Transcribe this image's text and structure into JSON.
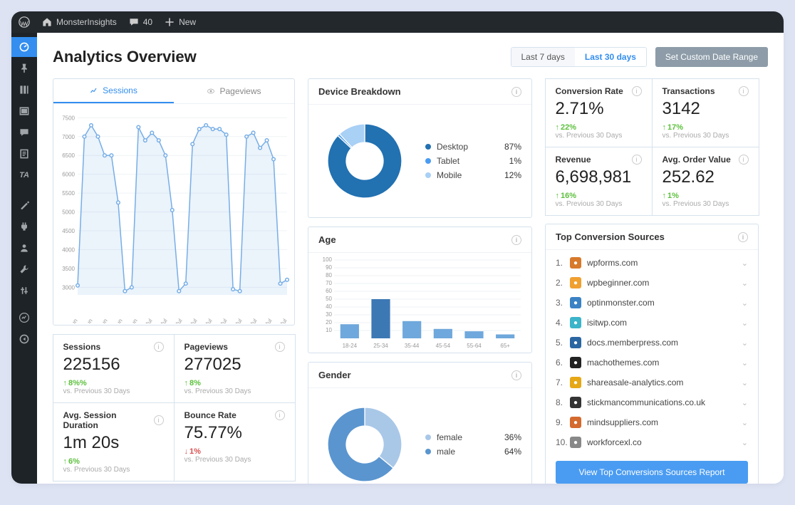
{
  "adminbar": {
    "site_name": "MonsterInsights",
    "comments_count": "40",
    "new_label": "New"
  },
  "page_title": "Analytics Overview",
  "date_tabs": {
    "last7": "Last 7 days",
    "last30": "Last 30 days",
    "custom_btn": "Set Custom Date Range"
  },
  "chart_tabs": {
    "sessions": "Sessions",
    "pageviews": "Pageviews"
  },
  "chart_data": {
    "sessions_line": {
      "type": "line",
      "y_ticks": [
        3000,
        3500,
        4000,
        4500,
        5000,
        5500,
        6000,
        6500,
        7000,
        7500
      ],
      "x_labels": [
        "22 Jun",
        "24 Jun",
        "26 Jun",
        "28 Jun",
        "30 Jun",
        "2 Jul",
        "4 Jul",
        "6 Jul",
        "8 Jul",
        "10 Jul",
        "12 Jul",
        "14 Jul",
        "16 Jul",
        "18 Jul",
        "21 Jul"
      ],
      "points": [
        3050,
        7000,
        7300,
        7000,
        6500,
        6500,
        5250,
        2900,
        3000,
        7250,
        6900,
        7100,
        6900,
        6500,
        5050,
        2900,
        3100,
        6800,
        7200,
        7300,
        7200,
        7200,
        7050,
        2950,
        2900,
        7000,
        7100,
        6700,
        6900,
        6400,
        3100,
        3200
      ],
      "ylim": [
        2800,
        7600
      ]
    },
    "device_donut": {
      "type": "pie",
      "title": "Device Breakdown",
      "series": [
        {
          "name": "Desktop",
          "value": 87,
          "color": "#2271b1"
        },
        {
          "name": "Tablet",
          "value": 1,
          "color": "#4a9cf2"
        },
        {
          "name": "Mobile",
          "value": 12,
          "color": "#a9d0f5"
        }
      ]
    },
    "age_bar": {
      "type": "bar",
      "title": "Age",
      "y_ticks": [
        10,
        20,
        30,
        40,
        50,
        60,
        70,
        80,
        90,
        100
      ],
      "categories": [
        "18-24",
        "25-34",
        "35-44",
        "45-54",
        "55-64",
        "65+"
      ],
      "values": [
        18,
        50,
        22,
        12,
        9,
        5
      ]
    },
    "gender_donut": {
      "type": "pie",
      "title": "Gender",
      "series": [
        {
          "name": "female",
          "value": 36,
          "color": "#a9c8e8"
        },
        {
          "name": "male",
          "value": 64,
          "color": "#5a95cf"
        }
      ]
    }
  },
  "stats": {
    "sessions": {
      "label": "Sessions",
      "value": "225156",
      "delta": "8%%",
      "dir": "up",
      "sub": "vs. Previous 30 Days"
    },
    "pageviews": {
      "label": "Pageviews",
      "value": "277025",
      "delta": "8%",
      "dir": "up",
      "sub": "vs. Previous 30 Days"
    },
    "avg_session": {
      "label": "Avg. Session Duration",
      "value": "1m 20s",
      "delta": "6%",
      "dir": "up",
      "sub": "vs. Previous 30 Days"
    },
    "bounce": {
      "label": "Bounce Rate",
      "value": "75.77%",
      "delta": "1%",
      "dir": "down",
      "sub": "vs. Previous 30 Days"
    }
  },
  "kpis": {
    "conv_rate": {
      "label": "Conversion Rate",
      "value": "2.71%",
      "delta": "22%",
      "dir": "up",
      "sub": "vs. Previous 30 Days"
    },
    "transactions": {
      "label": "Transactions",
      "value": "3142",
      "delta": "17%",
      "dir": "up",
      "sub": "vs. Previous 30 Days"
    },
    "revenue": {
      "label": "Revenue",
      "value": "6,698,981",
      "delta": "16%",
      "dir": "up",
      "sub": "vs. Previous 30 Days"
    },
    "aov": {
      "label": "Avg. Order Value",
      "value": "252.62",
      "delta": "1%",
      "dir": "up",
      "sub": "vs. Previous 30 Days"
    }
  },
  "sources": {
    "title": "Top Conversion Sources",
    "items": [
      {
        "n": "1.",
        "name": "wpforms.com",
        "ic": "#d77a2b"
      },
      {
        "n": "2.",
        "name": "wpbeginner.com",
        "ic": "#f0a030"
      },
      {
        "n": "3.",
        "name": "optinmonster.com",
        "ic": "#3b82c4"
      },
      {
        "n": "4.",
        "name": "isitwp.com",
        "ic": "#3cb4c9"
      },
      {
        "n": "5.",
        "name": "docs.memberpress.com",
        "ic": "#2a66a1"
      },
      {
        "n": "6.",
        "name": "machothemes.com",
        "ic": "#222"
      },
      {
        "n": "7.",
        "name": "shareasale-analytics.com",
        "ic": "#e6a817"
      },
      {
        "n": "8.",
        "name": "stickmancommunications.co.uk",
        "ic": "#333"
      },
      {
        "n": "9.",
        "name": "mindsuppliers.com",
        "ic": "#d46a2e"
      },
      {
        "n": "10.",
        "name": "workforcexl.co",
        "ic": "#888"
      }
    ],
    "button": "View Top Conversions Sources Report"
  }
}
